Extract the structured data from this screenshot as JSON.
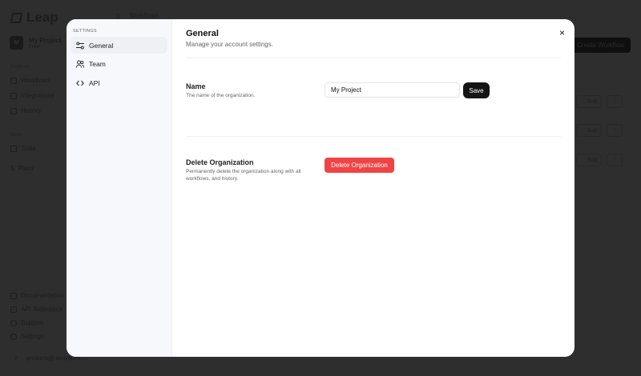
{
  "background": {
    "logo": "Leap",
    "project": {
      "initial": "M",
      "name": "My Project",
      "plan": "Free"
    },
    "platform_label": "Platform",
    "platform_items": [
      "Workflows",
      "Integrations",
      "History"
    ],
    "more_label": "More",
    "more_items": [
      "Tools",
      "Plans"
    ],
    "footer_items": [
      "Documentation",
      "API Reference",
      "Support",
      "Settings"
    ],
    "user_email": "products@nicelydone....",
    "breadcrumb": "Workflows",
    "create_label": "Create Workflow",
    "edit_label": "Edit",
    "more_glyph": "⋮"
  },
  "modal": {
    "sidebar_heading": "SETTINGS",
    "items": [
      {
        "label": "General"
      },
      {
        "label": "Team"
      },
      {
        "label": "API"
      }
    ],
    "title": "General",
    "subtitle": "Manage your account settings.",
    "name": {
      "label": "Name",
      "desc": "The name of the organization.",
      "value": "My Project",
      "save": "Save"
    },
    "delete": {
      "label": "Delete Organization",
      "desc": "Permanently delete the organization along with all workflows, and history.",
      "button": "Delete Organization"
    },
    "close": "×"
  },
  "colors": {
    "danger": "#ef4444",
    "primary": "#151515"
  }
}
